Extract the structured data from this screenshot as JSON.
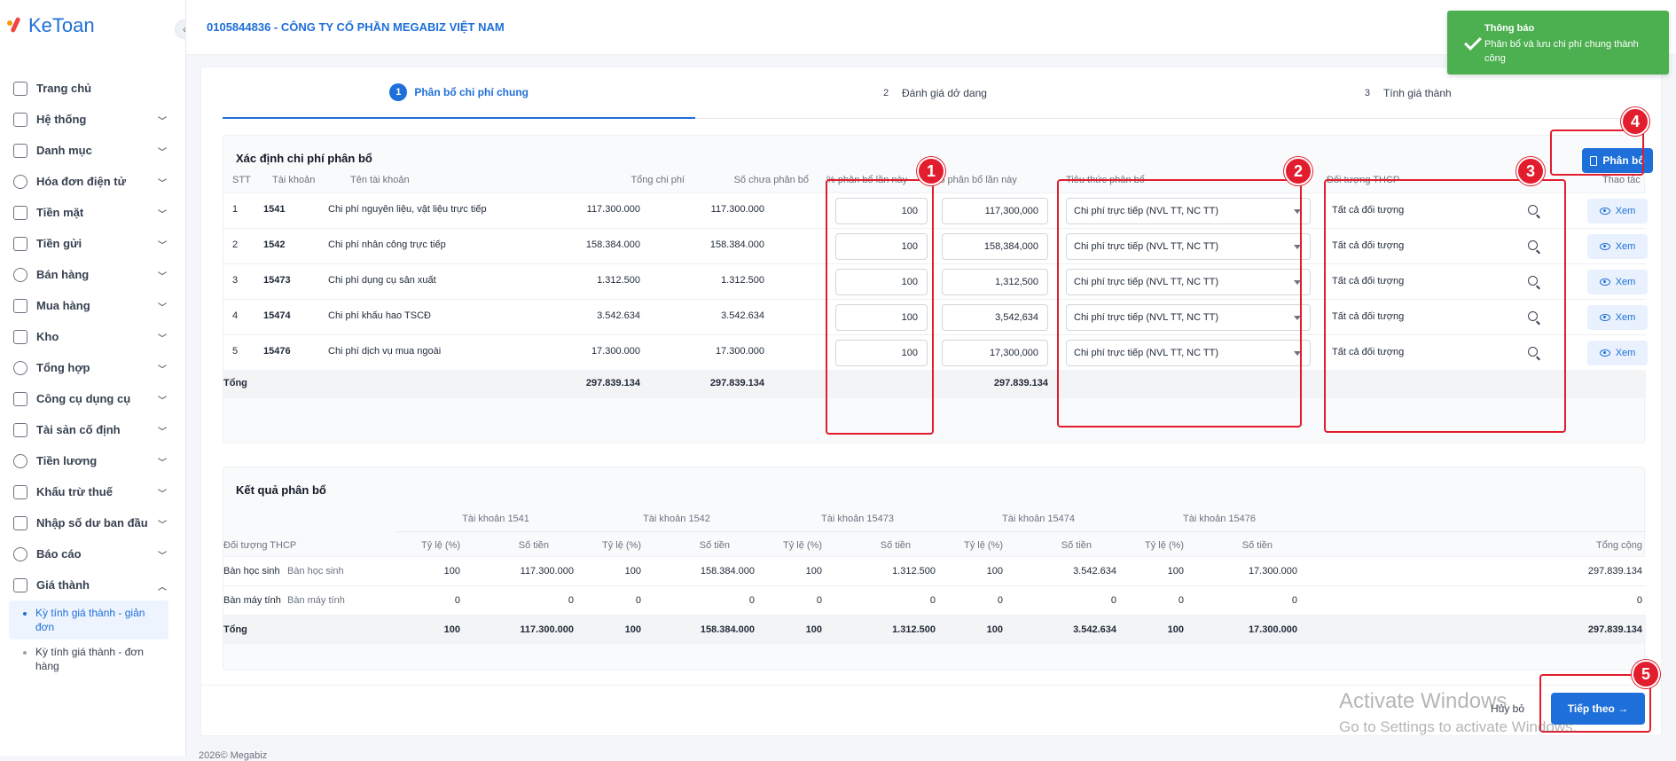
{
  "app": {
    "logo": "KeToan"
  },
  "company": "0105844836 - CÔNG TY CỔ PHẦN MEGABIZ VIỆT NAM",
  "sidebar": {
    "items": [
      {
        "label": "Trang chủ",
        "icon": "home-icon"
      },
      {
        "label": "Hệ thống",
        "icon": "gear-icon"
      },
      {
        "label": "Danh mục",
        "icon": "grid-icon"
      },
      {
        "label": "Hóa đơn điện tử",
        "icon": "invoice-icon"
      },
      {
        "label": "Tiền mặt",
        "icon": "cash-icon"
      },
      {
        "label": "Tiền gửi",
        "icon": "bank-card-icon"
      },
      {
        "label": "Bán hàng",
        "icon": "sales-icon"
      },
      {
        "label": "Mua hàng",
        "icon": "cart-icon"
      },
      {
        "label": "Kho",
        "icon": "warehouse-icon"
      },
      {
        "label": "Tổng hợp",
        "icon": "chart-icon"
      },
      {
        "label": "Công cụ dụng cụ",
        "icon": "tools-icon"
      },
      {
        "label": "Tài sản cố định",
        "icon": "car-icon"
      },
      {
        "label": "Tiền lương",
        "icon": "money-icon"
      },
      {
        "label": "Khấu trừ thuế",
        "icon": "building-icon"
      },
      {
        "label": "Nhập số dư ban đầu",
        "icon": "edit-icon"
      },
      {
        "label": "Báo cáo",
        "icon": "report-icon"
      },
      {
        "label": "Giá thành",
        "icon": "price-icon"
      }
    ],
    "subitems": [
      "Kỳ tính giá thành - giản đơn",
      "Kỳ tính giá thành - đơn hàng"
    ]
  },
  "steps": [
    {
      "num": "1",
      "label": "Phân bổ chi phí chung"
    },
    {
      "num": "2",
      "label": "Đánh giá dở dang"
    },
    {
      "num": "3",
      "label": "Tính giá thành"
    }
  ],
  "allocation": {
    "title": "Xác định chi phí phân bổ",
    "button": "Phân bổ",
    "headers": {
      "stt": "STT",
      "account": "Tài khoản",
      "name": "Tên tài khoản",
      "total": "Tổng chi phí",
      "unallocated": "Số chưa phân bổ",
      "percent": "% phân bổ lần này",
      "amount": "Số phân bổ lần này",
      "criteria": "Tiêu thức phân bổ",
      "object": "Đối tượng THCP",
      "action": "Thao tác"
    },
    "rows": [
      {
        "stt": "1",
        "account": "1541",
        "name": "Chi phí nguyên liệu, vật liệu trực tiếp",
        "total": "117.300.000",
        "unallocated": "117.300.000",
        "percent": "100",
        "amount": "117,300,000",
        "criteria": "Chi phí trực tiếp (NVL TT, NC TT)",
        "object": "Tất cả đối tượng",
        "action": "Xem"
      },
      {
        "stt": "2",
        "account": "1542",
        "name": "Chi phí nhân công trực tiếp",
        "total": "158.384.000",
        "unallocated": "158.384.000",
        "percent": "100",
        "amount": "158,384,000",
        "criteria": "Chi phí trực tiếp (NVL TT, NC TT)",
        "object": "Tất cả đối tượng",
        "action": "Xem"
      },
      {
        "stt": "3",
        "account": "15473",
        "name": "Chi phí dụng cụ sản xuất",
        "total": "1.312.500",
        "unallocated": "1.312.500",
        "percent": "100",
        "amount": "1,312,500",
        "criteria": "Chi phí trực tiếp (NVL TT, NC TT)",
        "object": "Tất cả đối tượng",
        "action": "Xem"
      },
      {
        "stt": "4",
        "account": "15474",
        "name": "Chi phí khấu hao TSCĐ",
        "total": "3.542.634",
        "unallocated": "3.542.634",
        "percent": "100",
        "amount": "3,542,634",
        "criteria": "Chi phí trực tiếp (NVL TT, NC TT)",
        "object": "Tất cả đối tượng",
        "action": "Xem"
      },
      {
        "stt": "5",
        "account": "15476",
        "name": "Chi phí dịch vụ mua ngoài",
        "total": "17.300.000",
        "unallocated": "17.300.000",
        "percent": "100",
        "amount": "17,300,000",
        "criteria": "Chi phí trực tiếp (NVL TT, NC TT)",
        "object": "Tất cả đối tượng",
        "action": "Xem"
      }
    ],
    "total": {
      "label": "Tổng",
      "total": "297.839.134",
      "unallocated": "297.839.134",
      "amount": "297.839.134"
    }
  },
  "result": {
    "title": "Kết quả phân bổ",
    "group_headers": [
      "Tài khoản 1541",
      "Tài khoản 1542",
      "Tài khoản 15473",
      "Tài khoản 15474",
      "Tài khoản 15476"
    ],
    "object_header": "Đối tượng THCP",
    "rate_header": "Tỷ lệ (%)",
    "amount_header": "Số tiền",
    "grand_header": "Tổng cộng",
    "rows": [
      {
        "code": "Bàn học sinh",
        "name": "Bàn học sinh",
        "values": [
          "100",
          "117.300.000",
          "100",
          "158.384.000",
          "100",
          "1.312.500",
          "100",
          "3.542.634",
          "100",
          "17.300.000"
        ],
        "total": "297.839.134"
      },
      {
        "code": "Bàn máy tính",
        "name": "Bàn máy tính",
        "values": [
          "0",
          "0",
          "0",
          "0",
          "0",
          "0",
          "0",
          "0",
          "0",
          "0"
        ],
        "total": "0"
      }
    ],
    "total": {
      "label": "Tổng",
      "values": [
        "100",
        "117.300.000",
        "100",
        "158.384.000",
        "100",
        "1.312.500",
        "100",
        "3.542.634",
        "100",
        "17.300.000"
      ],
      "total": "297.839.134"
    }
  },
  "footer_actions": {
    "cancel": "Hủy bỏ",
    "next": "Tiếp theo →"
  },
  "toast": {
    "title": "Thông báo",
    "message": "Phân bổ và lưu chi phí chung thành công"
  },
  "annotations": [
    "1",
    "2",
    "3",
    "4",
    "5"
  ],
  "watermark": {
    "line1": "Activate Windows",
    "line2": "Go to Settings to activate Windows."
  },
  "footer_text": "2026© Megabiz",
  "colors": {
    "primary": "#1e6fd9",
    "annotation": "#e11d2e",
    "toast": "#4caf50"
  }
}
